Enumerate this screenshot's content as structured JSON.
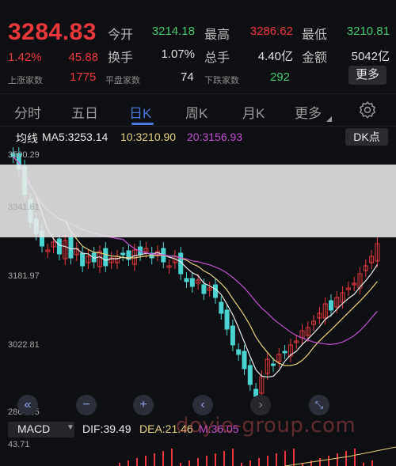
{
  "quote": {
    "price": "3284.83",
    "pct": "1.42%",
    "change": "45.88",
    "stats": [
      {
        "label": "今开",
        "value": "3214.18",
        "color": "#41c86c"
      },
      {
        "label": "最高",
        "value": "3286.62",
        "color": "#e8383d"
      },
      {
        "label": "最低",
        "value": "3210.81",
        "color": "#41c86c"
      },
      {
        "label": "换手",
        "value": "1.07%",
        "color": "#e0e0e0"
      },
      {
        "label": "总手",
        "value": "4.40亿",
        "color": "#e0e0e0"
      },
      {
        "label": "金额",
        "value": "5042亿",
        "color": "#e0e0e0"
      }
    ],
    "breadth": [
      {
        "label": "上涨家数",
        "value": "1775",
        "color": "#e8383d"
      },
      {
        "label": "平盘家数",
        "value": "74",
        "color": "#e0e0e0"
      },
      {
        "label": "下跌家数",
        "value": "292",
        "color": "#41c86c"
      }
    ],
    "more_label": "更多"
  },
  "tabs": [
    {
      "label": "分时",
      "active": false
    },
    {
      "label": "五日",
      "active": false
    },
    {
      "label": "日K",
      "active": true
    },
    {
      "label": "周K",
      "active": false
    },
    {
      "label": "月K",
      "active": false
    },
    {
      "label": "更多",
      "active": false
    }
  ],
  "ma": {
    "title": "均线",
    "ma5": "MA5:3253.14",
    "ma10": "10:3210.90",
    "ma20": "20:3156.93",
    "colors": {
      "ma5": "#e8e8e8",
      "ma10": "#e8d27a",
      "ma20": "#c04fd0"
    },
    "dk_label": "DK点"
  },
  "chart": {
    "y_labels": [
      "3500.29",
      "3341.61",
      "3181.97",
      "3022.81",
      "2863.65"
    ],
    "up_color": "#e8383d",
    "down_color": "#4ad3cf"
  },
  "controls": [
    "fast-rewind",
    "zoom-out",
    "zoom-in",
    "scroll-left",
    "scroll-right",
    "fullscreen"
  ],
  "macd": {
    "selector": "MACD",
    "dif": "DIF:39.49",
    "dea": "DEA:21.46",
    "m": "M:36.05",
    "top_value": "43.71"
  },
  "watermark": "doyie-group.com"
}
